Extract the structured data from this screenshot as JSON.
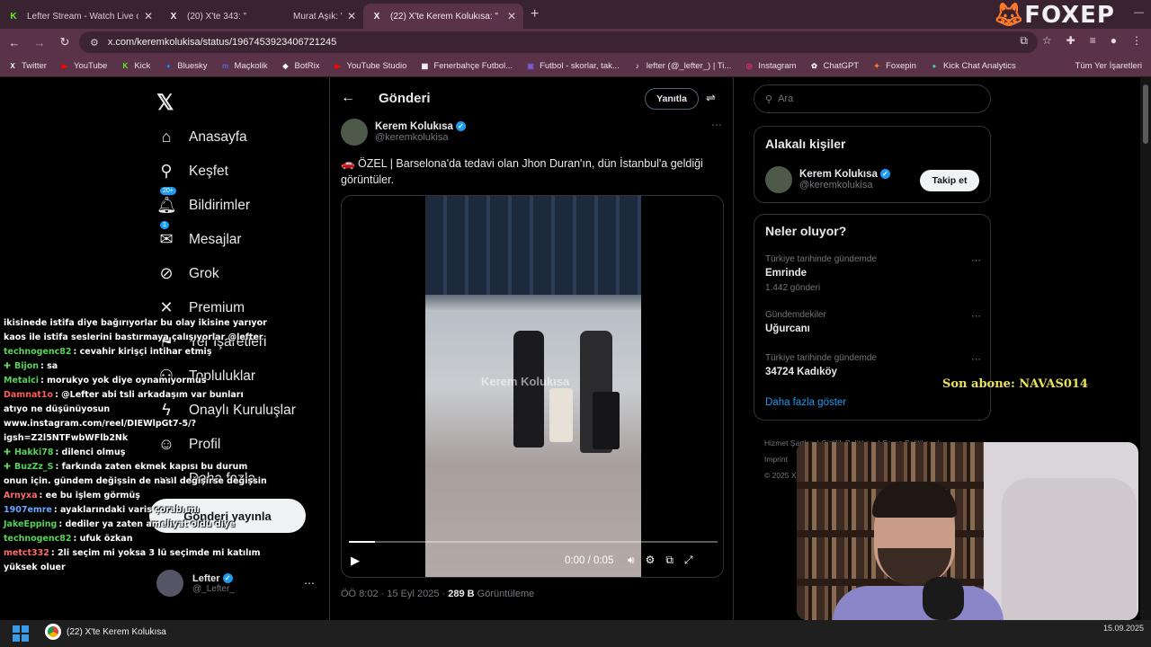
{
  "browser": {
    "tabs": [
      {
        "title": "Lefter Stream - Watch Live on K",
        "icon": "K",
        "icon_color": "#53fc18",
        "active": false
      },
      {
        "title": "(20) X'te 343: \"",
        "icon": "X",
        "icon_color": "#ffffff",
        "active": false
      },
      {
        "title": "Murat Aşık: \"",
        "icon": "",
        "icon_color": "#7b5cd6",
        "active": false
      },
      {
        "title": "(22) X'te Kerem Kolukısa: \"",
        "icon": "X",
        "icon_color": "#ffffff",
        "active": true
      }
    ],
    "brand_overlay": "FOXEP",
    "url": "x.com/keremkolukisa/status/1967453923406721245",
    "bookmarks": [
      {
        "label": "Twitter",
        "icon": "X",
        "color": "#ffffff"
      },
      {
        "label": "YouTube",
        "icon": "▶",
        "color": "#ff0000"
      },
      {
        "label": "Kick",
        "icon": "K",
        "color": "#53fc18"
      },
      {
        "label": "Bluesky",
        "icon": "♦",
        "color": "#1185fe"
      },
      {
        "label": "Maçkolik",
        "icon": "m",
        "color": "#5b6bd6"
      },
      {
        "label": "BotRix",
        "icon": "◆",
        "color": "#ffffff"
      },
      {
        "label": "YouTube Studio",
        "icon": "▶",
        "color": "#ff0000"
      },
      {
        "label": "Fenerbahçe Futbol...",
        "icon": "▦",
        "color": "#ffffff"
      },
      {
        "label": "Futbol - skorlar, tak...",
        "icon": "▣",
        "color": "#7b5cd6"
      },
      {
        "label": "lefter (@_lefter_) | Ti...",
        "icon": "♪",
        "color": "#ffffff"
      },
      {
        "label": "Instagram",
        "icon": "◎",
        "color": "#e1306c"
      },
      {
        "label": "ChatGPT",
        "icon": "✿",
        "color": "#ffffff"
      },
      {
        "label": "Foxepin",
        "icon": "✦",
        "color": "#ff7a2a"
      },
      {
        "label": "Kick Chat Analytics",
        "icon": "●",
        "color": "#37c7a8"
      }
    ],
    "bookmarks_all": "Tüm Yer İşaretleri"
  },
  "nav": {
    "items": [
      {
        "label": "Anasayfa",
        "icon": "home-icon",
        "glyph": "⌂",
        "badge": ""
      },
      {
        "label": "Keşfet",
        "icon": "search-icon",
        "glyph": "⚲",
        "badge": ""
      },
      {
        "label": "Bildirimler",
        "icon": "bell-icon",
        "glyph": "🔔︎",
        "badge": "20+"
      },
      {
        "label": "Mesajlar",
        "icon": "mail-icon",
        "glyph": "✉",
        "badge": "1"
      },
      {
        "label": "Grok",
        "icon": "grok-icon",
        "glyph": "⊘",
        "badge": ""
      },
      {
        "label": "Premium",
        "icon": "x-icon",
        "glyph": "✕",
        "badge": ""
      },
      {
        "label": "Yer İşaretleri",
        "icon": "bookmark-icon",
        "glyph": "⚑",
        "badge": ""
      },
      {
        "label": "Topluluklar",
        "icon": "people-icon",
        "glyph": "⚇",
        "badge": ""
      },
      {
        "label": "Onaylı Kuruluşlar",
        "icon": "lightning-icon",
        "glyph": "ϟ",
        "badge": ""
      },
      {
        "label": "Profil",
        "icon": "person-icon",
        "glyph": "☺",
        "badge": ""
      },
      {
        "label": "Daha fazla",
        "icon": "more-icon",
        "glyph": "⋯",
        "badge": ""
      }
    ],
    "post_button": "Gönderi yayınla",
    "account": {
      "name": "Lefter",
      "handle": "@_Lefter_"
    }
  },
  "post": {
    "header_title": "Gönderi",
    "reply_label": "Yanıtla",
    "author_name": "Kerem Kolukısa",
    "author_handle": "@keremkolukisa",
    "text": "🚗 ÖZEL | Barselona'da tedavi olan Jhon Duran'ın, dün İstanbul'a geldiği görüntüler.",
    "video_watermark": "Kerem Kolukısa",
    "video_time": "0:00 / 0:05",
    "video_progress": 0.07,
    "time": "ÖÖ 8:02 · 15 Eyl 2025 · ",
    "views_count": "289 B",
    "views_label": " Görüntüleme"
  },
  "sidebar": {
    "search_placeholder": "Ara",
    "related_title": "Alakalı kişiler",
    "related_name": "Kerem Kolukısa",
    "related_handle": "@keremkolukisa",
    "follow_label": "Takip et",
    "trends_title": "Neler oluyor?",
    "trends": [
      {
        "context": "Türkiye tarihinde gündemde",
        "title": "Emrinde",
        "count": "1.442 gönderi"
      },
      {
        "context": "Gündemdekiler",
        "title": "Uğurcanı",
        "count": ""
      },
      {
        "context": "Türkiye tarihinde gündemde",
        "title": "34724 Kadıköy",
        "count": ""
      }
    ],
    "show_more": "Daha fazla göster",
    "footer_line1": "Hizmet Şartları | Gizlilik Politikası | Çerez Politikası |",
    "footer_line2": "Imprint",
    "footer_line3": "© 2025 X"
  },
  "chat": [
    {
      "user": "",
      "msg": "ikisinede istifa diye bağırıyorlar bu olay ikisine yarıyor",
      "color": "#ffffff",
      "dia": false
    },
    {
      "user": "",
      "msg": "kaos ile istifa seslerini bastırmaya çalışıyorlar @lefter",
      "color": "#ffffff",
      "dia": false
    },
    {
      "user": "technogenc82",
      "msg": ": cevahir kirişçi intihar etmiş",
      "color": "#57d35a",
      "dia": false
    },
    {
      "user": "Bijon",
      "msg": ": sa",
      "color": "#57d35a",
      "dia": true
    },
    {
      "user": "Metalci",
      "msg": ": morukyo yok diye oynamıyormus",
      "color": "#57d35a",
      "dia": false
    },
    {
      "user": "Damnat1o",
      "msg": ": @Lefter abi tsli arkadaşım var bunları",
      "color": "#ff5a5a",
      "dia": false
    },
    {
      "user": "",
      "msg": "atıyo ne düşünüyosun",
      "color": "#ffffff",
      "dia": false
    },
    {
      "user": "",
      "msg": "www.instagram.com/reel/DIEWlpGt7-5/?",
      "color": "#ffffff",
      "dia": false
    },
    {
      "user": "",
      "msg": "igsh=Z2l5NTFwbWFlb2Nk",
      "color": "#ffffff",
      "dia": false
    },
    {
      "user": "Hakki78",
      "msg": ": dilenci olmuş",
      "color": "#57d35a",
      "dia": true
    },
    {
      "user": "BuzZz_S",
      "msg": ": farkında zaten ekmek kapısı bu durum",
      "color": "#57d35a",
      "dia": true
    },
    {
      "user": "",
      "msg": "onun için. gündem değişsin de nasıl değişirse değişsin",
      "color": "#ffffff",
      "dia": false
    },
    {
      "user": "Arnyxa",
      "msg": ": ee bu işlem görmüş",
      "color": "#ff6b6b",
      "dia": false
    },
    {
      "user": "1907emre",
      "msg": ": ayaklarındaki varis çorabı mı",
      "color": "#6aa7ff",
      "dia": false
    },
    {
      "user": "JakeEpping",
      "msg": ": dediler ya zaten ameliyat oldu diye",
      "color": "#57d35a",
      "dia": false
    },
    {
      "user": "technogenc82",
      "msg": ": ufuk özkan",
      "color": "#57d35a",
      "dia": false
    },
    {
      "user": "metct332",
      "msg": ": 2li seçim mi yoksa 3 lü seçimde mi katılım",
      "color": "#ff6b6b",
      "dia": false
    },
    {
      "user": "",
      "msg": "yüksek oluer",
      "color": "#ffffff",
      "dia": false
    }
  ],
  "stream_overlay": {
    "last_sub": "Son abone: NAVAS014"
  },
  "taskbar": {
    "app_title": "(22) X'te Kerem Kolukısa",
    "time": "",
    "date": "15.09.2025"
  }
}
